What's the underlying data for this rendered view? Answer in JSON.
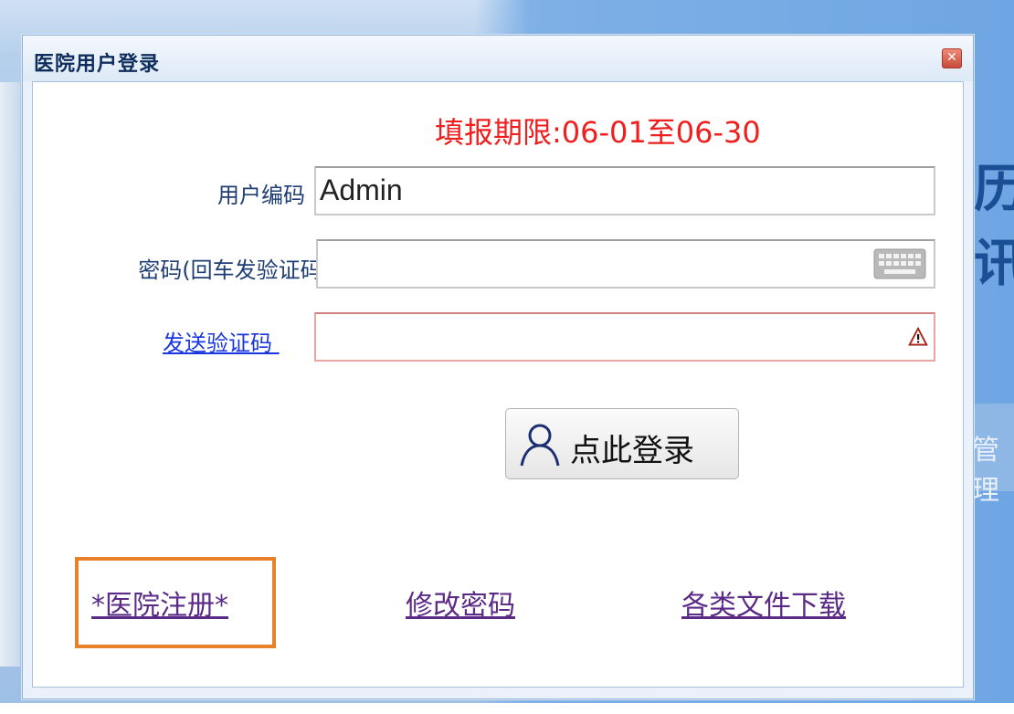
{
  "dialog": {
    "title": "医院用户登录",
    "close_icon": "close-icon"
  },
  "deadline": "填报期限:06-01至06-30",
  "form": {
    "user_code_label": "用户编码",
    "user_code_value": "Admin",
    "password_label": "密码(回车发验证码)",
    "password_value": "",
    "send_code_link": "发送验证码 ",
    "verification_value": ""
  },
  "login_button": {
    "label": "点此登录",
    "icon": "user-icon"
  },
  "links": {
    "register": "*医院注册*",
    "change_password": "修改密码",
    "downloads": "各类文件下载"
  },
  "background_fragments": {
    "char_1": "历",
    "char_2": "讯",
    "ghost_text": "管 理"
  },
  "colors": {
    "deadline_red": "#ef1f1f",
    "link_blue": "#1a36e0",
    "link_purple": "#5a2a86",
    "highlight_orange": "#e8822a"
  }
}
